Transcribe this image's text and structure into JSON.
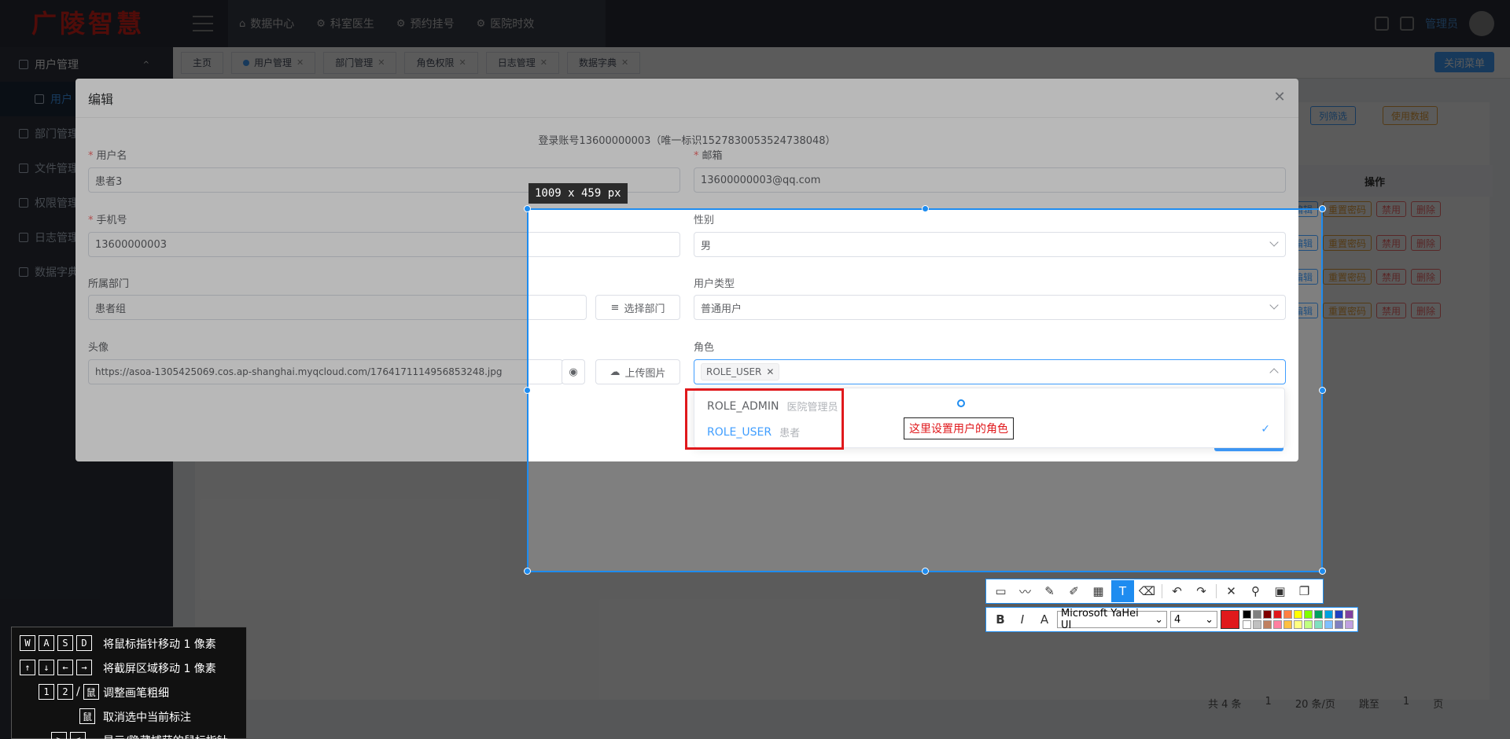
{
  "app": {
    "logo_text": "广陵智慧",
    "top_nav": [
      {
        "label": "数据中心",
        "icon": "home-icon"
      },
      {
        "label": "科室医生",
        "icon": "gear-icon"
      },
      {
        "label": "预约挂号",
        "icon": "gear-icon"
      },
      {
        "label": "医院时效",
        "icon": "gear-icon"
      }
    ],
    "user_name": "管理员",
    "sidebar": [
      {
        "label": "用户管理"
      },
      {
        "label": "用户"
      },
      {
        "label": "部门管理"
      },
      {
        "label": "文件管理"
      },
      {
        "label": "权限管理"
      },
      {
        "label": "日志管理"
      },
      {
        "label": "数据字典"
      }
    ],
    "tags": [
      "主页",
      "用户管理",
      "部门管理",
      "角色权限",
      "日志管理",
      "数据字典"
    ],
    "close_menu_label": "关闭菜单",
    "toolbar_buttons": [
      "列筛选",
      "使用数据"
    ],
    "ops_header": "操作",
    "ops_row": [
      "编辑",
      "重置密码",
      "禁用",
      "删除"
    ],
    "pagination": {
      "total": "共 4 条",
      "page": "1",
      "page_size": "20 条/页",
      "jump_label": "跳至",
      "jump_value": "1",
      "page_suffix": "页"
    }
  },
  "dialog": {
    "title": "编辑",
    "subtitle": "登录账号13600000003（唯一标识1527830053524738048）",
    "fields": {
      "username": {
        "label": "用户名",
        "value": "患者3"
      },
      "email": {
        "label": "邮箱",
        "value": "13600000003@qq.com"
      },
      "phone": {
        "label": "手机号",
        "value": "13600000003"
      },
      "gender": {
        "label": "性别",
        "value": "男"
      },
      "department": {
        "label": "所属部门",
        "value": "患者组"
      },
      "user_type": {
        "label": "用户类型",
        "value": "普通用户"
      },
      "avatar": {
        "label": "头像",
        "value": "https://asoa-1305425069.cos.ap-shanghai.myqcloud.com/1764171114956853248.jpg"
      },
      "role": {
        "label": "角色",
        "tag": "ROLE_USER"
      }
    },
    "select_dept_button": "选择部门",
    "upload_button": "上传图片",
    "role_options": [
      {
        "code": "ROLE_ADMIN",
        "desc": "医院管理员",
        "selected": false
      },
      {
        "code": "ROLE_USER",
        "desc": "患者",
        "selected": true
      }
    ]
  },
  "capture": {
    "size_label": "1009 x 459  px",
    "annotation_text": "这里设置用户的角色",
    "font_name": "Microsoft YaHei UI",
    "font_size": "4",
    "current_color": "#e0191c",
    "palette": [
      "#000000",
      "#808080",
      "#800000",
      "#e0191c",
      "#ff8040",
      "#ffff00",
      "#80ff00",
      "#00a060",
      "#00a0e0",
      "#2040c0",
      "#8040a0",
      "#ffffff",
      "#c0c0c0",
      "#c08060",
      "#ff80a0",
      "#ffc040",
      "#ffff80",
      "#c0ff80",
      "#80e0c0",
      "#80c0ff",
      "#8080c0",
      "#c0a0e0"
    ],
    "tools": [
      "rect-icon",
      "polyline-icon",
      "pen-icon",
      "marker-icon",
      "mosaic-icon",
      "text-icon",
      "eraser-icon",
      "undo-icon",
      "redo-icon",
      "cancel-icon",
      "pin-icon",
      "save-icon",
      "copy-icon"
    ]
  },
  "shortcuts": [
    {
      "keys": [
        "W",
        "A",
        "S",
        "D"
      ],
      "text": "将鼠标指针移动 1 像素"
    },
    {
      "keys": [
        "↑",
        "↓",
        "←",
        "→"
      ],
      "text": "将截屏区域移动 1 像素"
    },
    {
      "keys": [
        "1",
        "2",
        "/",
        "鼠"
      ],
      "text": "调整画笔粗细"
    },
    {
      "keys": [
        "鼠"
      ],
      "text": "取消选中当前标注"
    },
    {
      "keys": [
        ">",
        "<"
      ],
      "text": "显示/隐藏捕获的鼠标指针"
    }
  ]
}
